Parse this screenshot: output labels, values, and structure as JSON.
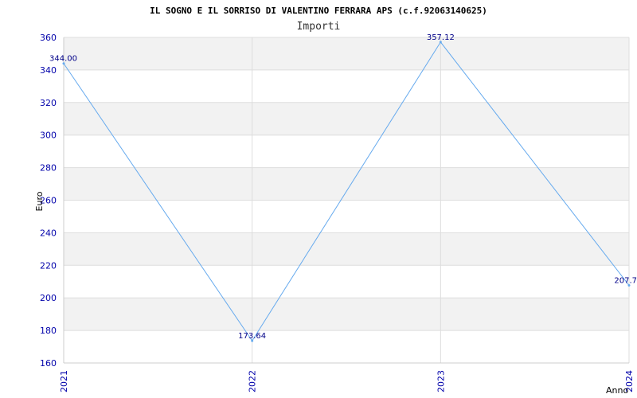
{
  "chart_data": {
    "type": "line",
    "title": "IL SOGNO E IL SORRISO DI VALENTINO FERRARA APS (c.f.92063140625)",
    "subtitle": "Importi",
    "xlabel": "Anno",
    "ylabel": "Euro",
    "ylim": [
      160,
      360
    ],
    "yticks": [
      "160",
      "180",
      "200",
      "220",
      "240",
      "260",
      "280",
      "300",
      "320",
      "340",
      "360"
    ],
    "categories": [
      "2021",
      "2022",
      "2023",
      "2024"
    ],
    "series": [
      {
        "values": [
          344.0,
          173.64,
          357.12,
          207.7
        ],
        "labels": [
          "344.00",
          "173.64",
          "357.12",
          "207.7"
        ]
      }
    ],
    "grid": true,
    "colors": {
      "line": "#66aaee",
      "band": "#f2f2f2",
      "tick_text": "#0000aa"
    }
  }
}
